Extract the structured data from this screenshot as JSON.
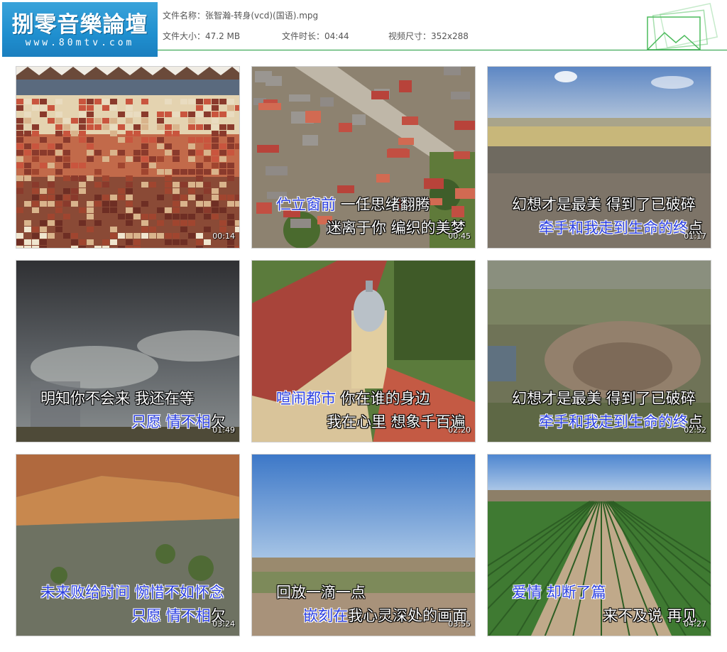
{
  "logo": {
    "title": "捌零音樂論壇",
    "url": "www.80mtv.com"
  },
  "file": {
    "name_label": "文件名称：",
    "name": "张智瀚-转身(vcd)(国语).mpg",
    "size_label": "文件大小：",
    "size": "47.2 MB",
    "duration_label": "文件时长：",
    "duration": "04:44",
    "dimensions_label": "视频尺寸：",
    "dimensions": "352x288"
  },
  "colors": {
    "accent_line": "#1e9a3a",
    "logo_bg": "#2196d3",
    "lyric_highlight": "#2b3fe0"
  },
  "thumbnails": [
    {
      "scene": "tiled-wall",
      "timestamp": "00:14",
      "lyric1": {
        "hl": "",
        "rest": ""
      },
      "lyric2": {
        "hl": "",
        "rest": ""
      }
    },
    {
      "scene": "township-aerial",
      "timestamp": "00:45",
      "lyric1": {
        "hl": "伫立窗前",
        "rest": " 一任思绪翻腾"
      },
      "lyric2": {
        "hl": "",
        "rest": "迷离于你 编织的美梦"
      }
    },
    {
      "scene": "plain-landscape",
      "timestamp": "01:17",
      "lyric1": {
        "hl": "",
        "rest": "幻想才是最美 得到了已破碎"
      },
      "lyric2": {
        "hl": "牵手和我走到生命的终",
        "rest": "点"
      }
    },
    {
      "scene": "storm-clouds",
      "timestamp": "01:49",
      "lyric1": {
        "hl": "",
        "rest": "明知你不会来 我还在等"
      },
      "lyric2": {
        "hl": "只愿 情不相",
        "rest": "欠"
      }
    },
    {
      "scene": "domed-building",
      "timestamp": "02:20",
      "lyric1": {
        "hl": "喧闹都市",
        "rest": " 你在谁的身边"
      },
      "lyric2": {
        "hl": "",
        "rest": "我在心里 想象千百遍"
      }
    },
    {
      "scene": "big-hole-aerial",
      "timestamp": "02:52",
      "lyric1": {
        "hl": "",
        "rest": "幻想才是最美 得到了已破碎"
      },
      "lyric2": {
        "hl": "牵手和我走到生命的终",
        "rest": "点"
      }
    },
    {
      "scene": "crater-cliff",
      "timestamp": "03:24",
      "lyric1": {
        "hl": "未来败给时间 惋惜不如怀念",
        "rest": ""
      },
      "lyric2": {
        "hl": "只愿 情不相",
        "rest": "欠"
      }
    },
    {
      "scene": "blue-sky-plain",
      "timestamp": "03:55",
      "lyric1": {
        "hl": "",
        "rest": "回放一滴一点"
      },
      "lyric2": {
        "hl": "嵌刻在",
        "rest": "我心灵深处的画面"
      }
    },
    {
      "scene": "green-fields",
      "timestamp": "04:27",
      "lyric1": {
        "hl": "爱情 却断了篇",
        "rest": ""
      },
      "lyric2": {
        "hl": "",
        "rest": "来不及说 再见"
      }
    }
  ]
}
